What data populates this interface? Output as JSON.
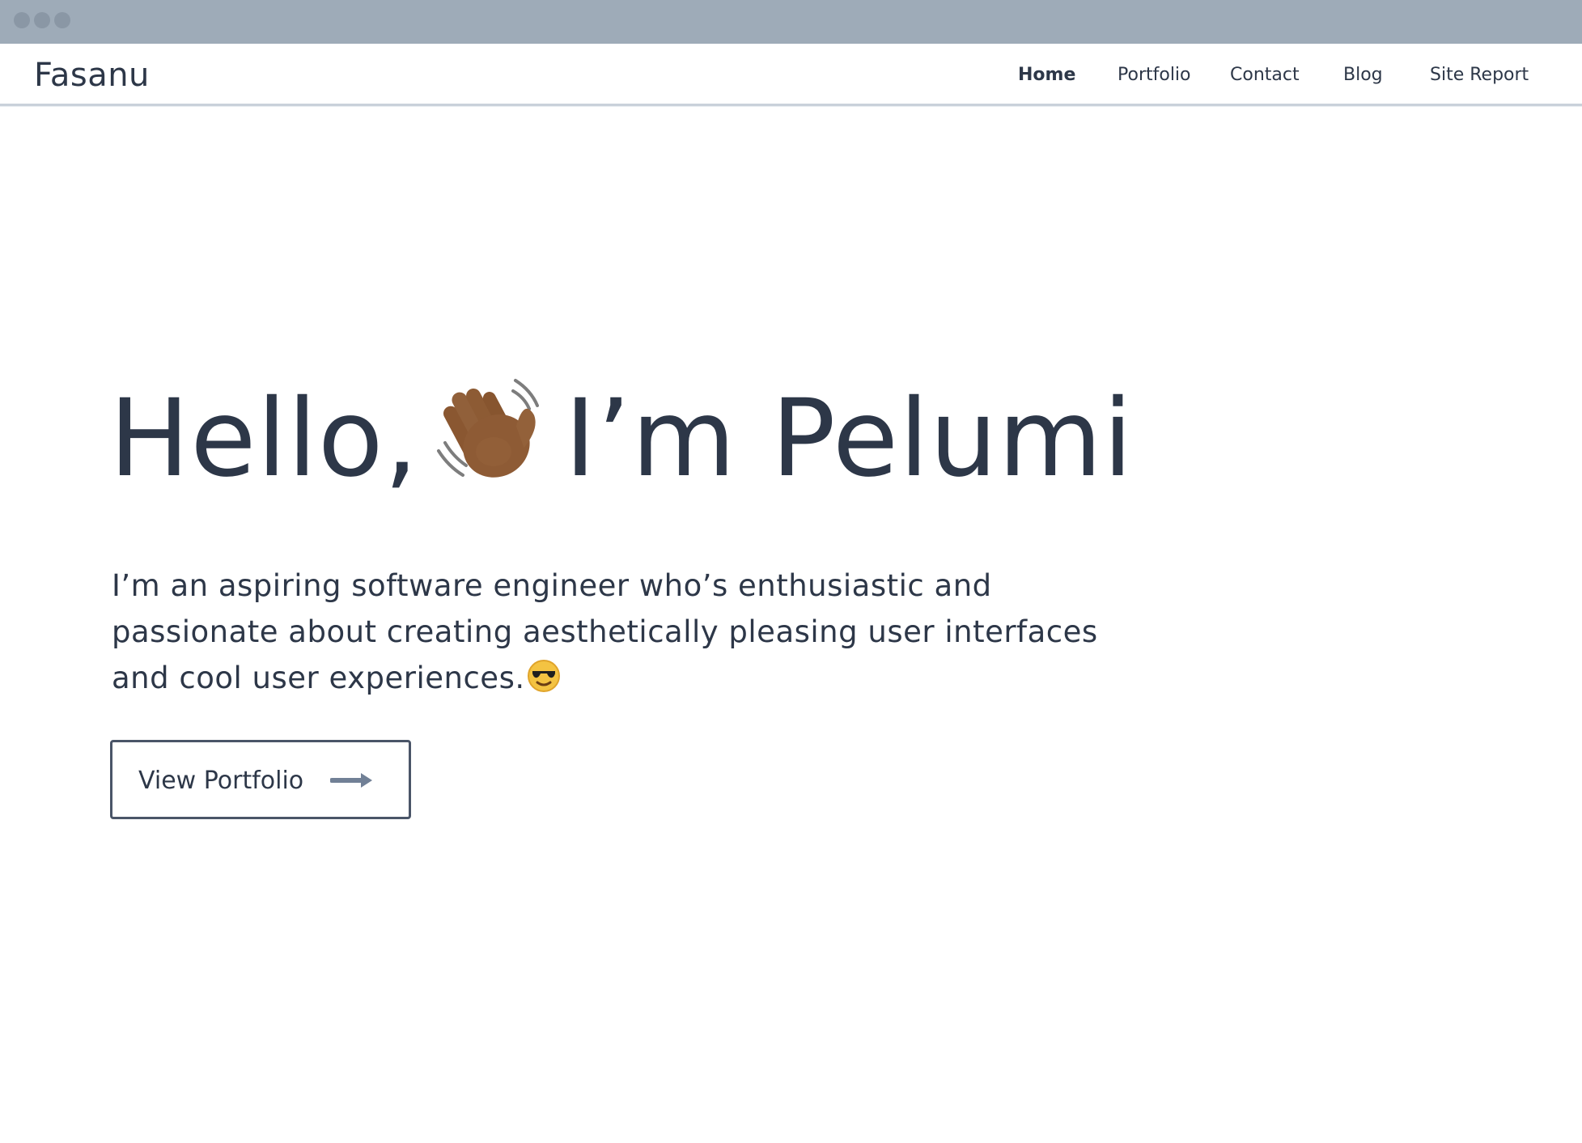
{
  "browser": {
    "window_dots": [
      "close",
      "minimize",
      "maximize"
    ]
  },
  "header": {
    "brand": "Fasanu",
    "nav": [
      {
        "label": "Home",
        "active": true
      },
      {
        "label": "Portfolio",
        "active": false
      },
      {
        "label": "Contact",
        "active": false
      },
      {
        "label": "Blog",
        "active": false
      },
      {
        "label": "Site Report",
        "active": false
      }
    ]
  },
  "hero": {
    "greeting_prefix": "Hello,",
    "greeting_icon": "waving-hand-icon",
    "greeting_suffix": "I’m Pelumi",
    "intro": "I’m an aspiring software engineer who’s enthusiastic and passionate about creating aesthetically pleasing user interfaces and cool user experiences.",
    "intro_icon": "sunglasses-face-icon",
    "cta": {
      "label": "View Portfolio",
      "icon": "arrow-right-icon"
    }
  },
  "colors": {
    "text": "#2d3748",
    "chrome": "#9eabb8",
    "border": "#4a5568",
    "arrow": "#718096"
  }
}
